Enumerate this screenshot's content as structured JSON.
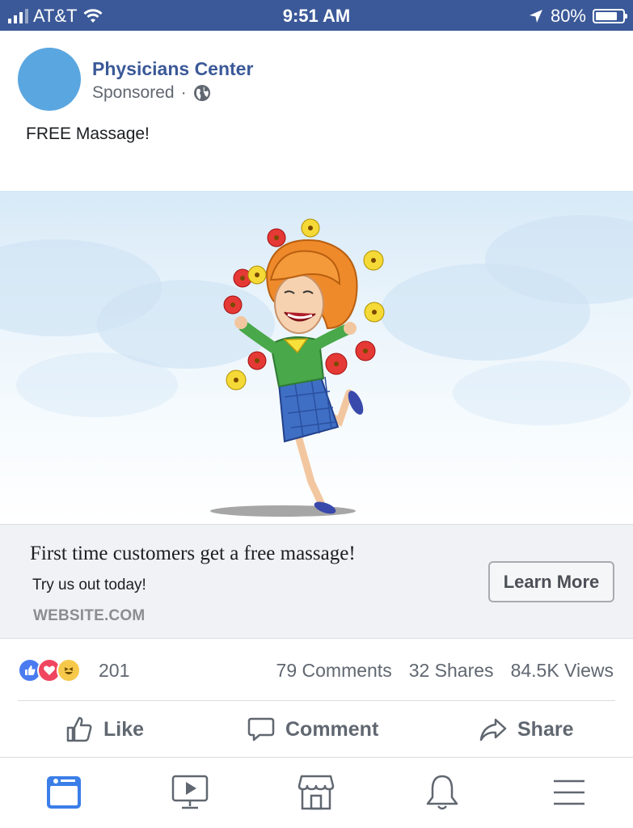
{
  "status_bar": {
    "carrier": "AT&T",
    "time": "9:51 AM",
    "battery": "80%",
    "battery_level": 0.8
  },
  "post": {
    "page_name": "Physicians Center",
    "sponsored_label": "Sponsored",
    "separator": "·",
    "text": "FREE Massage!"
  },
  "link_preview": {
    "headline": "First time customers get a free massage!",
    "description": "Try us out today!",
    "domain": "WEBSITE.COM",
    "cta_label": "Learn More"
  },
  "engagement": {
    "reaction_icons": [
      "like-icon",
      "love-icon",
      "haha-icon"
    ],
    "reaction_count": "201",
    "comments": "79 Comments",
    "shares": "32 Shares",
    "views": "84.5K Views"
  },
  "actions": {
    "like": "Like",
    "comment": "Comment",
    "share": "Share"
  },
  "tabbar": {
    "items": [
      "news-feed-icon",
      "watch-icon",
      "marketplace-icon",
      "notifications-icon",
      "menu-icon"
    ]
  },
  "colors": {
    "brand": "#3b5998",
    "avatar": "#5aa6e0",
    "active_tab": "#3b7ee8",
    "inactive_icon": "#606770"
  }
}
